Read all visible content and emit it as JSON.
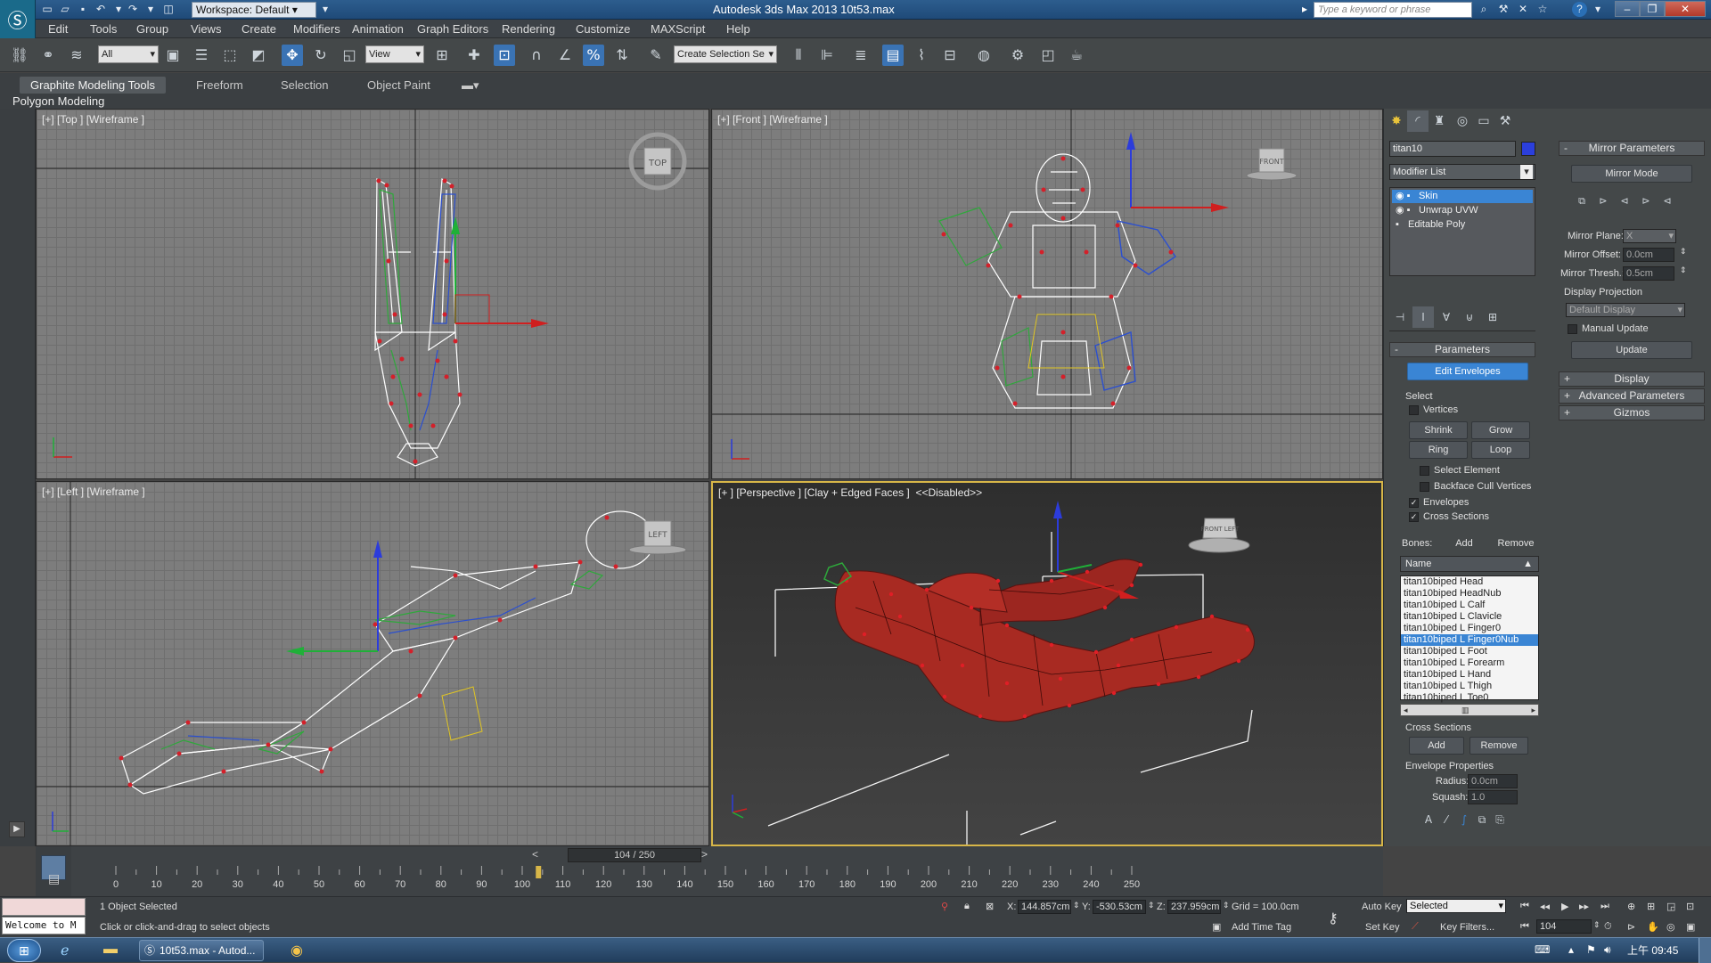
{
  "window": {
    "title": "Autodesk 3ds Max 2013    10t53.max",
    "workspace": "Workspace: Default",
    "search_placeholder": "Type a keyword or phrase"
  },
  "menu": [
    "Edit",
    "Tools",
    "Group",
    "Views",
    "Create",
    "Modifiers",
    "Animation",
    "Graph Editors",
    "Rendering",
    "Customize",
    "MAXScript",
    "Help"
  ],
  "toolbar": {
    "filter_dropdown": "All",
    "coord_dropdown": "View",
    "selection_set": "Create Selection Se"
  },
  "ribbon": {
    "tabs": [
      "Graphite Modeling Tools",
      "Freeform",
      "Selection",
      "Object Paint"
    ],
    "panel_label": "Polygon Modeling"
  },
  "viewports": {
    "top": {
      "label": "[+] [Top ] [Wireframe ]",
      "cube": "TOP"
    },
    "front": {
      "label": "[+] [Front ] [Wireframe ]",
      "cube": "FRONT"
    },
    "left": {
      "label": "[+] [Left ] [Wireframe ]",
      "cube": "LEFT"
    },
    "perspective": {
      "label": "[+ ] [Perspective ] [Clay + Edged Faces ]  <<Disabled>>",
      "cube": "FRONT LEFT"
    }
  },
  "command_panel": {
    "object_name": "titan10",
    "modifier_list": "Modifier List",
    "stack": [
      {
        "label": "Skin",
        "selected": true
      },
      {
        "label": "Unwrap UVW",
        "selected": false
      },
      {
        "label": "Editable Poly",
        "selected": false
      }
    ],
    "parameters": {
      "header": "Parameters",
      "edit_envelopes": "Edit Envelopes",
      "select_label": "Select",
      "vertices": "Vertices",
      "shrink": "Shrink",
      "grow": "Grow",
      "ring": "Ring",
      "loop": "Loop",
      "select_element": "Select Element",
      "backface_cull": "Backface Cull Vertices",
      "envelopes": "Envelopes",
      "cross_sections": "Cross Sections",
      "bones_label": "Bones:",
      "add": "Add",
      "remove": "Remove",
      "name_header": "Name",
      "bones": [
        {
          "name": "titan10biped Head",
          "selected": false
        },
        {
          "name": "titan10biped HeadNub",
          "selected": false
        },
        {
          "name": "titan10biped L Calf",
          "selected": false
        },
        {
          "name": "titan10biped L Clavicle",
          "selected": false
        },
        {
          "name": "titan10biped L Finger0",
          "selected": false
        },
        {
          "name": "titan10biped L Finger0Nub",
          "selected": true
        },
        {
          "name": "titan10biped L Foot",
          "selected": false
        },
        {
          "name": "titan10biped L Forearm",
          "selected": false
        },
        {
          "name": "titan10biped L Hand",
          "selected": false
        },
        {
          "name": "titan10biped L Thigh",
          "selected": false
        },
        {
          "name": "titan10biped L Toe0",
          "selected": false
        }
      ],
      "cross_sections_label": "Cross Sections",
      "cs_add": "Add",
      "cs_remove": "Remove",
      "envelope_properties": "Envelope Properties",
      "radius_label": "Radius:",
      "radius_value": "0.0cm",
      "squash_label": "Squash:",
      "squash_value": "1.0"
    },
    "mirror": {
      "header": "Mirror Parameters",
      "mirror_mode": "Mirror Mode",
      "mirror_plane_label": "Mirror Plane:",
      "mirror_plane_value": "X",
      "mirror_offset_label": "Mirror Offset:",
      "mirror_offset_value": "0.0cm",
      "mirror_thresh_label": "Mirror Thresh.:",
      "mirror_thresh_value": "0.5cm",
      "display_projection_label": "Display Projection",
      "display_projection_value": "Default Display",
      "manual_update": "Manual Update",
      "update": "Update"
    },
    "rollouts": [
      "Display",
      "Advanced Parameters",
      "Gizmos"
    ]
  },
  "timeline": {
    "slider": "104 / 250",
    "current_frame": 104,
    "total_frames": 250,
    "ticks": [
      "0",
      "10",
      "20",
      "30",
      "40",
      "50",
      "60",
      "70",
      "80",
      "90",
      "100",
      "110",
      "120",
      "130",
      "140",
      "150",
      "160",
      "170",
      "180",
      "190",
      "200",
      "210",
      "220",
      "230",
      "240",
      "250"
    ]
  },
  "status": {
    "welcome": "Welcome to M",
    "selected": "1 Object Selected",
    "prompt": "Click or click-and-drag to select objects",
    "x_label": "X:",
    "x_value": "144.857cm",
    "y_label": "Y:",
    "y_value": "-530.53cm",
    "z_label": "Z:",
    "z_value": "237.959cm",
    "grid": "Grid = 100.0cm",
    "add_time_tag": "Add Time Tag",
    "auto_key": "Auto Key",
    "set_key": "Set Key",
    "key_mode": "Selected",
    "key_filters": "Key Filters...",
    "frame_field": "104"
  },
  "taskbar": {
    "active_window": "10t53.max - Autod...",
    "clock": "上午 09:45"
  },
  "colors": {
    "accent_blue": "#3a85d4",
    "active_viewport": "#d7b648",
    "skin_red": "#a82a22"
  }
}
